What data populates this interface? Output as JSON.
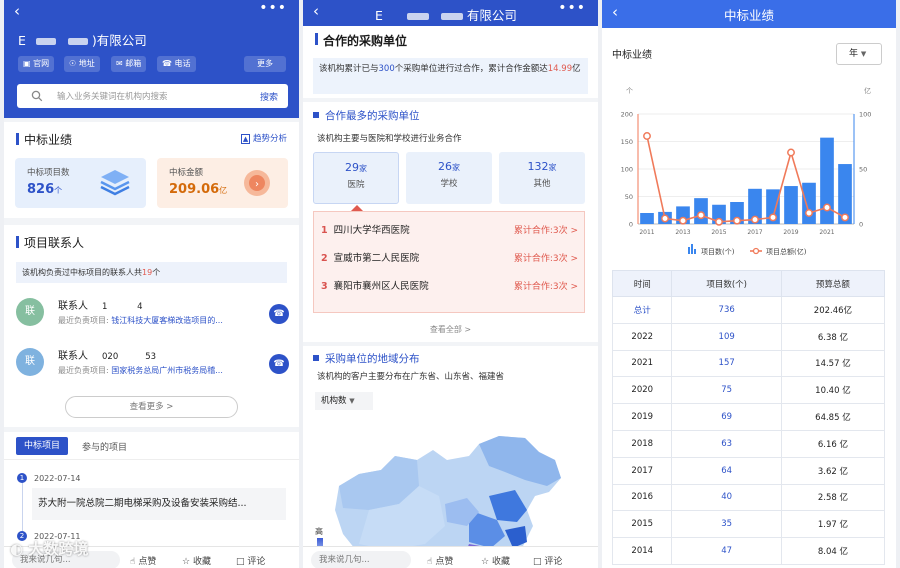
{
  "panel1": {
    "back_icon": "chevron-left-icon",
    "more_icon": "more-dots-icon",
    "company_prefix": "E",
    "company_suffix": ")有限公司",
    "chips": [
      "官网",
      "地址",
      "邮箱",
      "电话"
    ],
    "more_label": "更多",
    "search_placeholder": "输入业务关键词在机构内搜索",
    "search_button": "搜索",
    "award_section": {
      "title": "中标业绩",
      "trend_label": "趋势分析",
      "stats": [
        {
          "label": "中标项目数",
          "value": "826",
          "unit": "个"
        },
        {
          "label": "中标金额",
          "value": "209.06",
          "unit": "亿"
        }
      ]
    },
    "contacts_section": {
      "title": "项目联系人",
      "note_prefix": "该机构负责过中标项目的联系人共",
      "note_count": "19",
      "note_suffix": "个",
      "contacts": [
        {
          "avatar": "联",
          "name": "联系人",
          "number": "1           4",
          "project_label": "最近负责项目:",
          "project": "钱江科技大厦客梯改造项目的..."
        },
        {
          "avatar": "联",
          "name": "联系人",
          "number": "020          53",
          "project_label": "最近负责项目:",
          "project": "国家税务总局广州市税务局稽..."
        }
      ],
      "view_more": "查看更多 >"
    },
    "tabs": [
      "中标项目",
      "参与的项目"
    ],
    "projects": [
      {
        "date": "2022-07-14",
        "title": "苏大附一院总院二期电梯采购及设备安装采购结..."
      },
      {
        "date": "2022-07-11"
      }
    ]
  },
  "bottom_bar": {
    "comment_placeholder": "我来说几句...",
    "like": "点赞",
    "fav": "收藏",
    "comment": "评论"
  },
  "panel2": {
    "title_prefix": "E",
    "title_suffix": "有限公司",
    "coop_section": {
      "title": "合作的采购单位",
      "desc_prefix": "该机构累计已与",
      "desc_count": "300",
      "desc_mid": "个采购单位进行过合作，累计合作金额达",
      "desc_amount": "14.99",
      "desc_unit": "亿"
    },
    "most_section": {
      "title": "合作最多的采购单位",
      "desc": "该机构主要与医院和学校进行业务合作",
      "cards": [
        {
          "num": "29",
          "unit": "家",
          "label": "医院"
        },
        {
          "num": "26",
          "unit": "家",
          "label": "学校"
        },
        {
          "num": "132",
          "unit": "家",
          "label": "其他"
        }
      ],
      "ranks": [
        {
          "rank": "1",
          "name": "四川大学华西医院",
          "action": "累计合作:3次 >"
        },
        {
          "rank": "2",
          "name": "宣威市第二人民医院",
          "action": "累计合作:3次 >"
        },
        {
          "rank": "3",
          "name": "襄阳市襄州区人民医院",
          "action": "累计合作:3次 >"
        }
      ],
      "view_all": "查看全部 >"
    },
    "region_section": {
      "title": "采购单位的地域分布",
      "desc": "该机构的客户主要分布在广东省、山东省、福建省",
      "select": "机构数",
      "legend_high": "高"
    }
  },
  "panel3": {
    "title": "中标业绩",
    "chart_title": "中标业绩",
    "period": "年"
  },
  "chart_data": {
    "type": "bar",
    "categories": [
      "2011",
      "2012",
      "2013",
      "2014",
      "2015",
      "2016",
      "2017",
      "2018",
      "2019",
      "2020",
      "2021",
      "2022"
    ],
    "x_tick_labels": [
      "2011",
      "2013",
      "2015",
      "2017",
      "2019",
      "2021"
    ],
    "left_axis_label": "个",
    "right_axis_label": "亿",
    "left_ticks": [
      0,
      50,
      100,
      150,
      200
    ],
    "right_ticks": [
      0,
      50,
      100
    ],
    "ylim": [
      0,
      200
    ],
    "y2lim": [
      0,
      100
    ],
    "series": [
      {
        "name": "项目数(个)",
        "type": "bar",
        "color": "#3a86ee",
        "values": [
          20,
          22,
          32,
          47,
          35,
          40,
          64,
          63,
          69,
          75,
          157,
          109
        ]
      },
      {
        "name": "项目总额(亿)",
        "type": "line",
        "color": "#f07a5a",
        "values": [
          80,
          5,
          3,
          8,
          2,
          3,
          4,
          6,
          65,
          10,
          15,
          6
        ]
      }
    ],
    "table": {
      "headers": [
        "时间",
        "项目数(个)",
        "预算总额"
      ],
      "rows": [
        [
          "总计",
          "736",
          "202.46亿"
        ],
        [
          "2022",
          "109",
          "6.38 亿"
        ],
        [
          "2021",
          "157",
          "14.57 亿"
        ],
        [
          "2020",
          "75",
          "10.40 亿"
        ],
        [
          "2019",
          "69",
          "64.85 亿"
        ],
        [
          "2018",
          "63",
          "6.16 亿"
        ],
        [
          "2017",
          "64",
          "3.62 亿"
        ],
        [
          "2016",
          "40",
          "2.58 亿"
        ],
        [
          "2015",
          "35",
          "1.97 亿"
        ],
        [
          "2014",
          "47",
          "8.04 亿"
        ]
      ]
    }
  },
  "watermark": "大数跨境"
}
